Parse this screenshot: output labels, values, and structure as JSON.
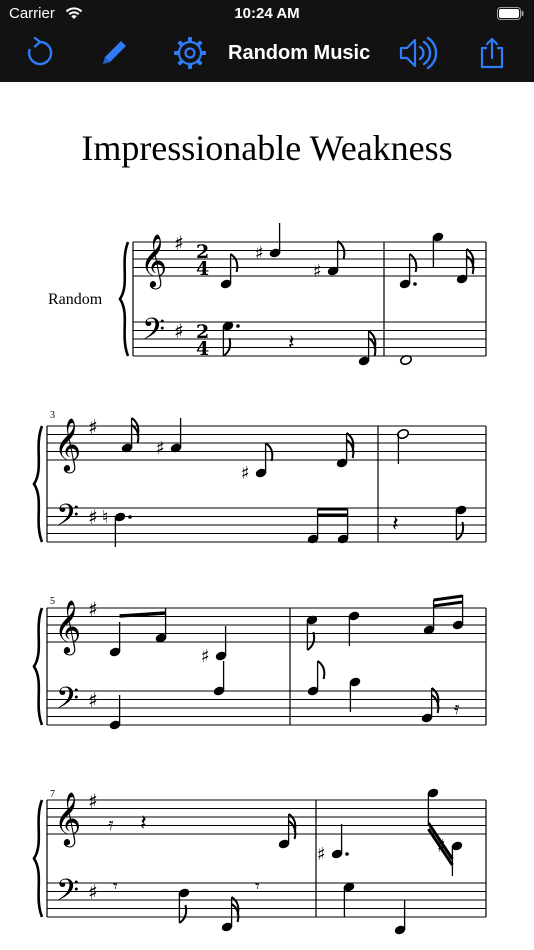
{
  "status_bar": {
    "carrier": "Carrier",
    "time": "10:24 AM",
    "wifi_icon": "wifi-icon",
    "battery_icon": "battery-icon"
  },
  "toolbar": {
    "title": "Random Music",
    "buttons": [
      {
        "name": "refresh-button",
        "icon": "refresh-icon"
      },
      {
        "name": "edit-button",
        "icon": "pencil-icon"
      },
      {
        "name": "settings-button",
        "icon": "gear-icon"
      },
      {
        "name": "sound-button",
        "icon": "speaker-icon"
      },
      {
        "name": "share-button",
        "icon": "share-icon"
      }
    ],
    "accent": "#2f7cf6",
    "background": "#121212"
  },
  "score": {
    "title": "Impressionable Weakness",
    "part_name": "Random",
    "time_signature": {
      "numerator": "2",
      "denominator": "4"
    },
    "key_signature": "G major (one sharp)",
    "measure_numbers": [
      "3",
      "5",
      "7"
    ]
  }
}
